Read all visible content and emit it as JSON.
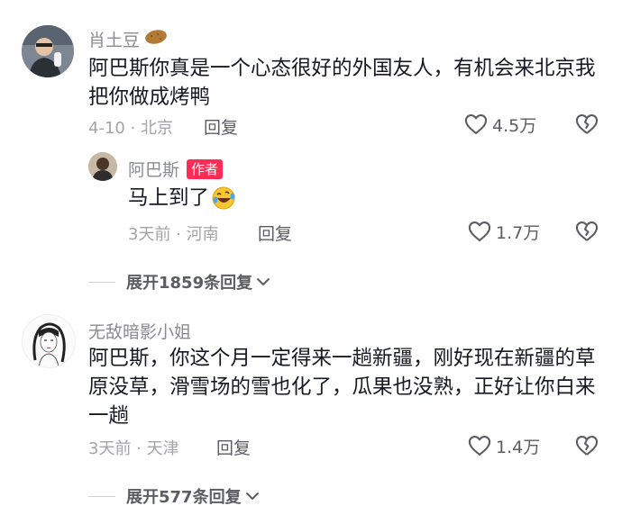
{
  "comments": [
    {
      "username": "肖土豆",
      "username_emoji": "potato",
      "text": "阿巴斯你真是一个心态很好的外国友人，有机会来北京我把你做成烤鸭",
      "meta": "4-10 · 北京",
      "reply_label": "回复",
      "like_count": "4.5万",
      "replies": [
        {
          "username": "阿巴斯",
          "badge": "作者",
          "text": "马上到了",
          "text_emoji": "rolling-laughing",
          "meta": "3天前 · 河南",
          "reply_label": "回复",
          "like_count": "1.7万"
        }
      ],
      "expand_label": "展开1859条回复"
    },
    {
      "username": "无敌暗影小姐",
      "text": "阿巴斯，你这个月一定得来一趟新疆，刚好现在新疆的草原没草，滑雪场的雪也化了，瓜果也没熟，正好让你白来一趟",
      "meta": "3天前 · 天津",
      "reply_label": "回复",
      "like_count": "1.4万",
      "expand_label": "展开577条回复"
    }
  ],
  "colors": {
    "text_primary": "#161823",
    "text_secondary": "#8a8b91",
    "author_badge": "#fe2c55"
  }
}
